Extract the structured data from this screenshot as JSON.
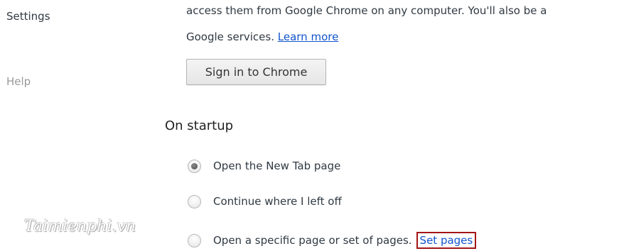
{
  "sidebar": {
    "items": [
      {
        "label": "Settings"
      },
      {
        "label": "Help"
      }
    ]
  },
  "sign_in": {
    "description_line1": "access them from Google Chrome on any computer. You'll also be a",
    "description_line2": "Google services.",
    "learn_more_label": "Learn more",
    "button_label": "Sign in to Chrome"
  },
  "startup": {
    "title": "On startup",
    "options": [
      {
        "label": "Open the New Tab page",
        "selected": true
      },
      {
        "label": "Continue where I left off",
        "selected": false
      },
      {
        "label": "Open a specific page or set of pages.",
        "selected": false
      }
    ],
    "set_pages_label": "Set pages"
  },
  "watermark": {
    "text": "Taimienphi.vn"
  },
  "colors": {
    "link": "#1155cc",
    "highlight_border": "#a31515",
    "text": "#303942",
    "muted": "#999999"
  }
}
